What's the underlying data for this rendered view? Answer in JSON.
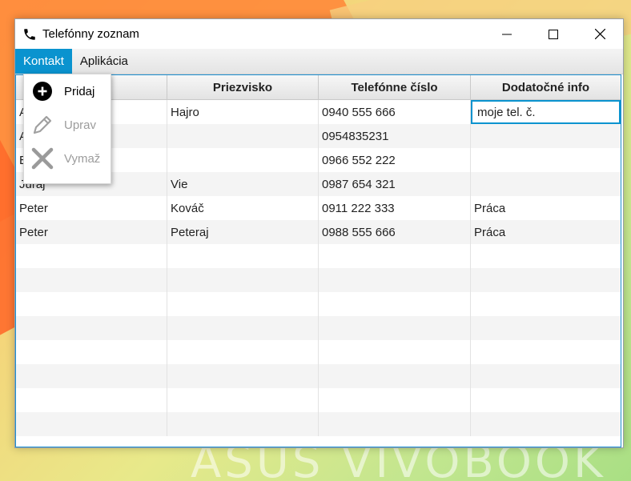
{
  "window": {
    "title": "Telefónny zoznam"
  },
  "menubar": {
    "items": [
      {
        "label": "Kontakt"
      },
      {
        "label": "Aplikácia"
      }
    ]
  },
  "table": {
    "headers": [
      "",
      "Priezvisko",
      "Telefónne číslo",
      "Dodatočné info"
    ],
    "rows": [
      [
        "A",
        "Hajro",
        "0940 555 666",
        "moje tel. č."
      ],
      [
        "A",
        "",
        "0954835231",
        ""
      ],
      [
        "B",
        "",
        "0966 552 222",
        ""
      ],
      [
        "Juraj",
        "Vie",
        "0987 654 321",
        ""
      ],
      [
        "Peter",
        "Kováč",
        "0911 222 333",
        "Práca"
      ],
      [
        "Peter",
        "Peteraj",
        "0988 555 666",
        "Práca"
      ]
    ]
  },
  "context_menu": {
    "items": [
      {
        "label": "Pridaj",
        "icon": "plus-circle-icon",
        "enabled": true
      },
      {
        "label": "Uprav",
        "icon": "pencil-icon",
        "enabled": false
      },
      {
        "label": "Vymaž",
        "icon": "x-icon",
        "enabled": false
      }
    ]
  },
  "desktop": {
    "watermark": "ASUS VIVOBOOK"
  },
  "colors": {
    "accent": "#0a93cf",
    "menu_active_bg": "#0a93cf"
  }
}
